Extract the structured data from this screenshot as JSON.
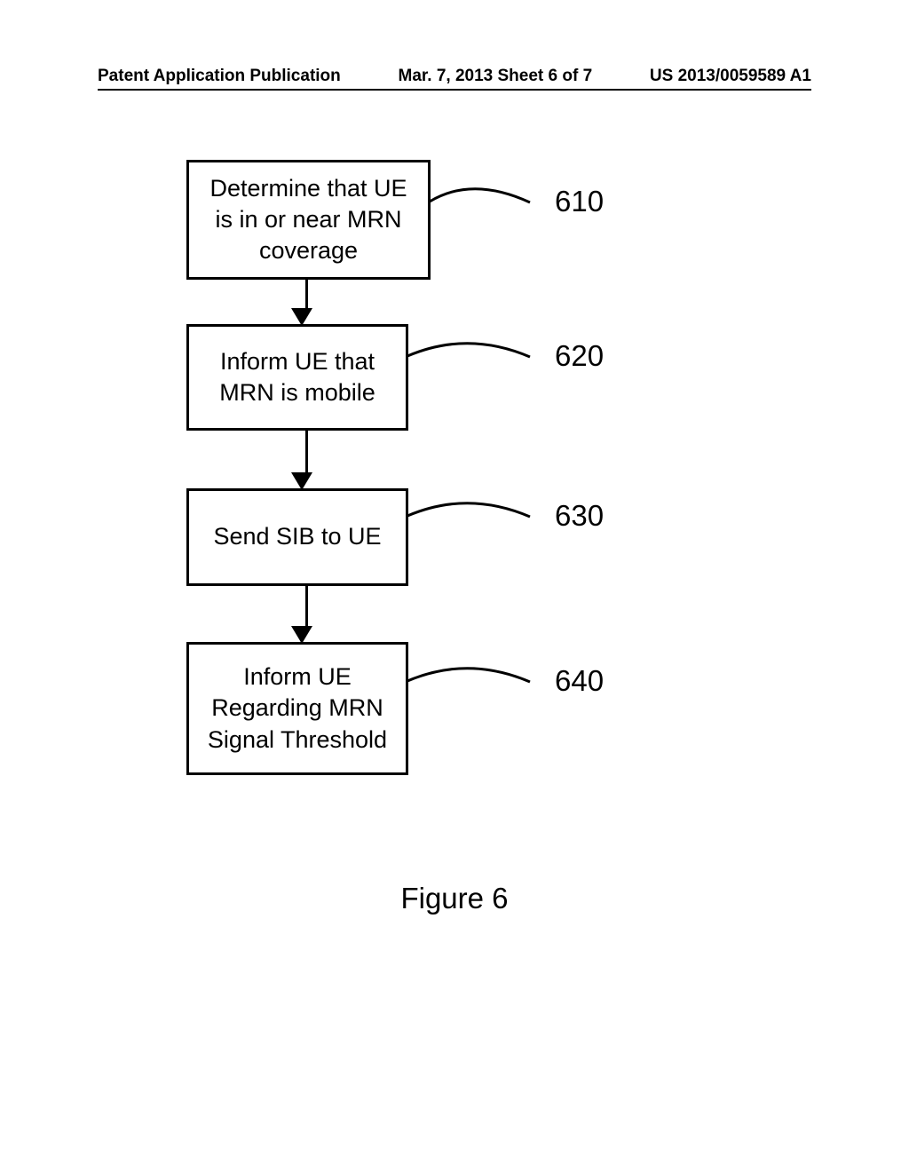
{
  "header": {
    "left": "Patent Application Publication",
    "center": "Mar. 7, 2013  Sheet 6 of 7",
    "right": "US 2013/0059589 A1"
  },
  "flowchart": {
    "step1": {
      "text": "Determine that UE is in or near MRN coverage",
      "ref": "610"
    },
    "step2": {
      "text": "Inform UE that MRN is mobile",
      "ref": "620"
    },
    "step3": {
      "text": "Send SIB to UE",
      "ref": "630"
    },
    "step4": {
      "text": "Inform UE Regarding MRN Signal Threshold",
      "ref": "640"
    }
  },
  "caption": "Figure 6"
}
